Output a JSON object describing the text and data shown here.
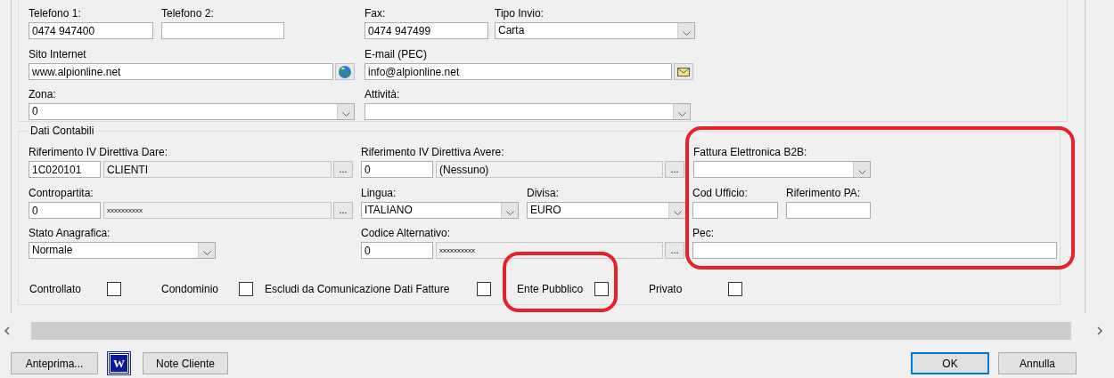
{
  "contact_section": {
    "rows": [
      [
        {
          "kind": "text",
          "label": "Telefono 1:",
          "value": "0474 947400"
        },
        {
          "kind": "text",
          "label": "Telefono 2:"
        },
        {
          "kind": "text",
          "label": "Fax:",
          "value": "0474 947499"
        },
        {
          "kind": "combo",
          "label": "Tipo Invio:",
          "value": "Carta"
        }
      ],
      [
        {
          "kind": "url",
          "label": "Sito Internet",
          "value": "www.alpionline.net"
        },
        {
          "kind": "email",
          "label": "E-mail (PEC)",
          "value": "info@alpionline.net"
        }
      ],
      [
        {
          "kind": "combo",
          "label": "Zona:",
          "value": "0"
        },
        {
          "kind": "combo",
          "label": "Attività:"
        }
      ]
    ]
  },
  "accounting_section": {
    "title": "Dati Contabili",
    "rows": [
      [
        [
          {
            "kind": "lookup",
            "label": "Riferimento IV Direttiva Dare:",
            "value": "1C020101",
            "description": "CLIENTI",
            "readonly": true,
            "masked": false,
            "button": "..."
          }
        ],
        [
          {
            "kind": "lookup",
            "label": "Riferimento IV Direttiva Avere:",
            "value": "0",
            "description": "(Nessuno)",
            "readonly": true,
            "masked": false,
            "button": "..."
          }
        ],
        [
          {
            "kind": "combo",
            "label": "Fattura Elettronica B2B:"
          }
        ]
      ],
      [
        [
          {
            "kind": "lookup",
            "label": "Contropartita:",
            "value": "0",
            "description": "xxxxxxxxxx",
            "readonly": true,
            "masked": true,
            "button": "..."
          }
        ],
        [
          {
            "kind": "combo",
            "label": "Lingua:",
            "value": "ITALIANO"
          },
          {
            "kind": "combo",
            "label": "Divisa:",
            "value": "EURO"
          }
        ],
        [
          {
            "kind": "text",
            "label": "Cod Ufficio:"
          },
          {
            "kind": "text",
            "label": "Riferimento PA:"
          }
        ]
      ],
      [
        [
          {
            "kind": "combo",
            "label": "Stato Anagrafica:",
            "value": "Normale"
          }
        ],
        [
          {
            "kind": "lookup",
            "label": "Codice Alternativo:",
            "value": "0",
            "description": "xxxxxxxxxx",
            "readonly": true,
            "masked": true,
            "button": "..."
          }
        ],
        [
          {
            "kind": "text",
            "label": "Pec:"
          }
        ]
      ]
    ],
    "checkboxes": [
      {
        "label": "Controllato",
        "checked": false
      },
      {
        "label": "Condominio",
        "checked": false
      },
      {
        "label": "Escludi da Comunicazione Dati Fatture",
        "checked": false
      },
      {
        "label": "Ente Pubblico",
        "checked": false
      },
      {
        "label": "Privato",
        "checked": false
      }
    ]
  },
  "footer": {
    "buttons": [
      {
        "kind": "text",
        "label": "Anteprima...",
        "default": false
      },
      {
        "kind": "icon",
        "label": "W",
        "default": false
      },
      {
        "kind": "text",
        "label": "Note Cliente",
        "default": false
      },
      {
        "kind": "text",
        "label": "OK",
        "default": true
      },
      {
        "kind": "text",
        "label": "Annulla",
        "default": false
      }
    ]
  }
}
